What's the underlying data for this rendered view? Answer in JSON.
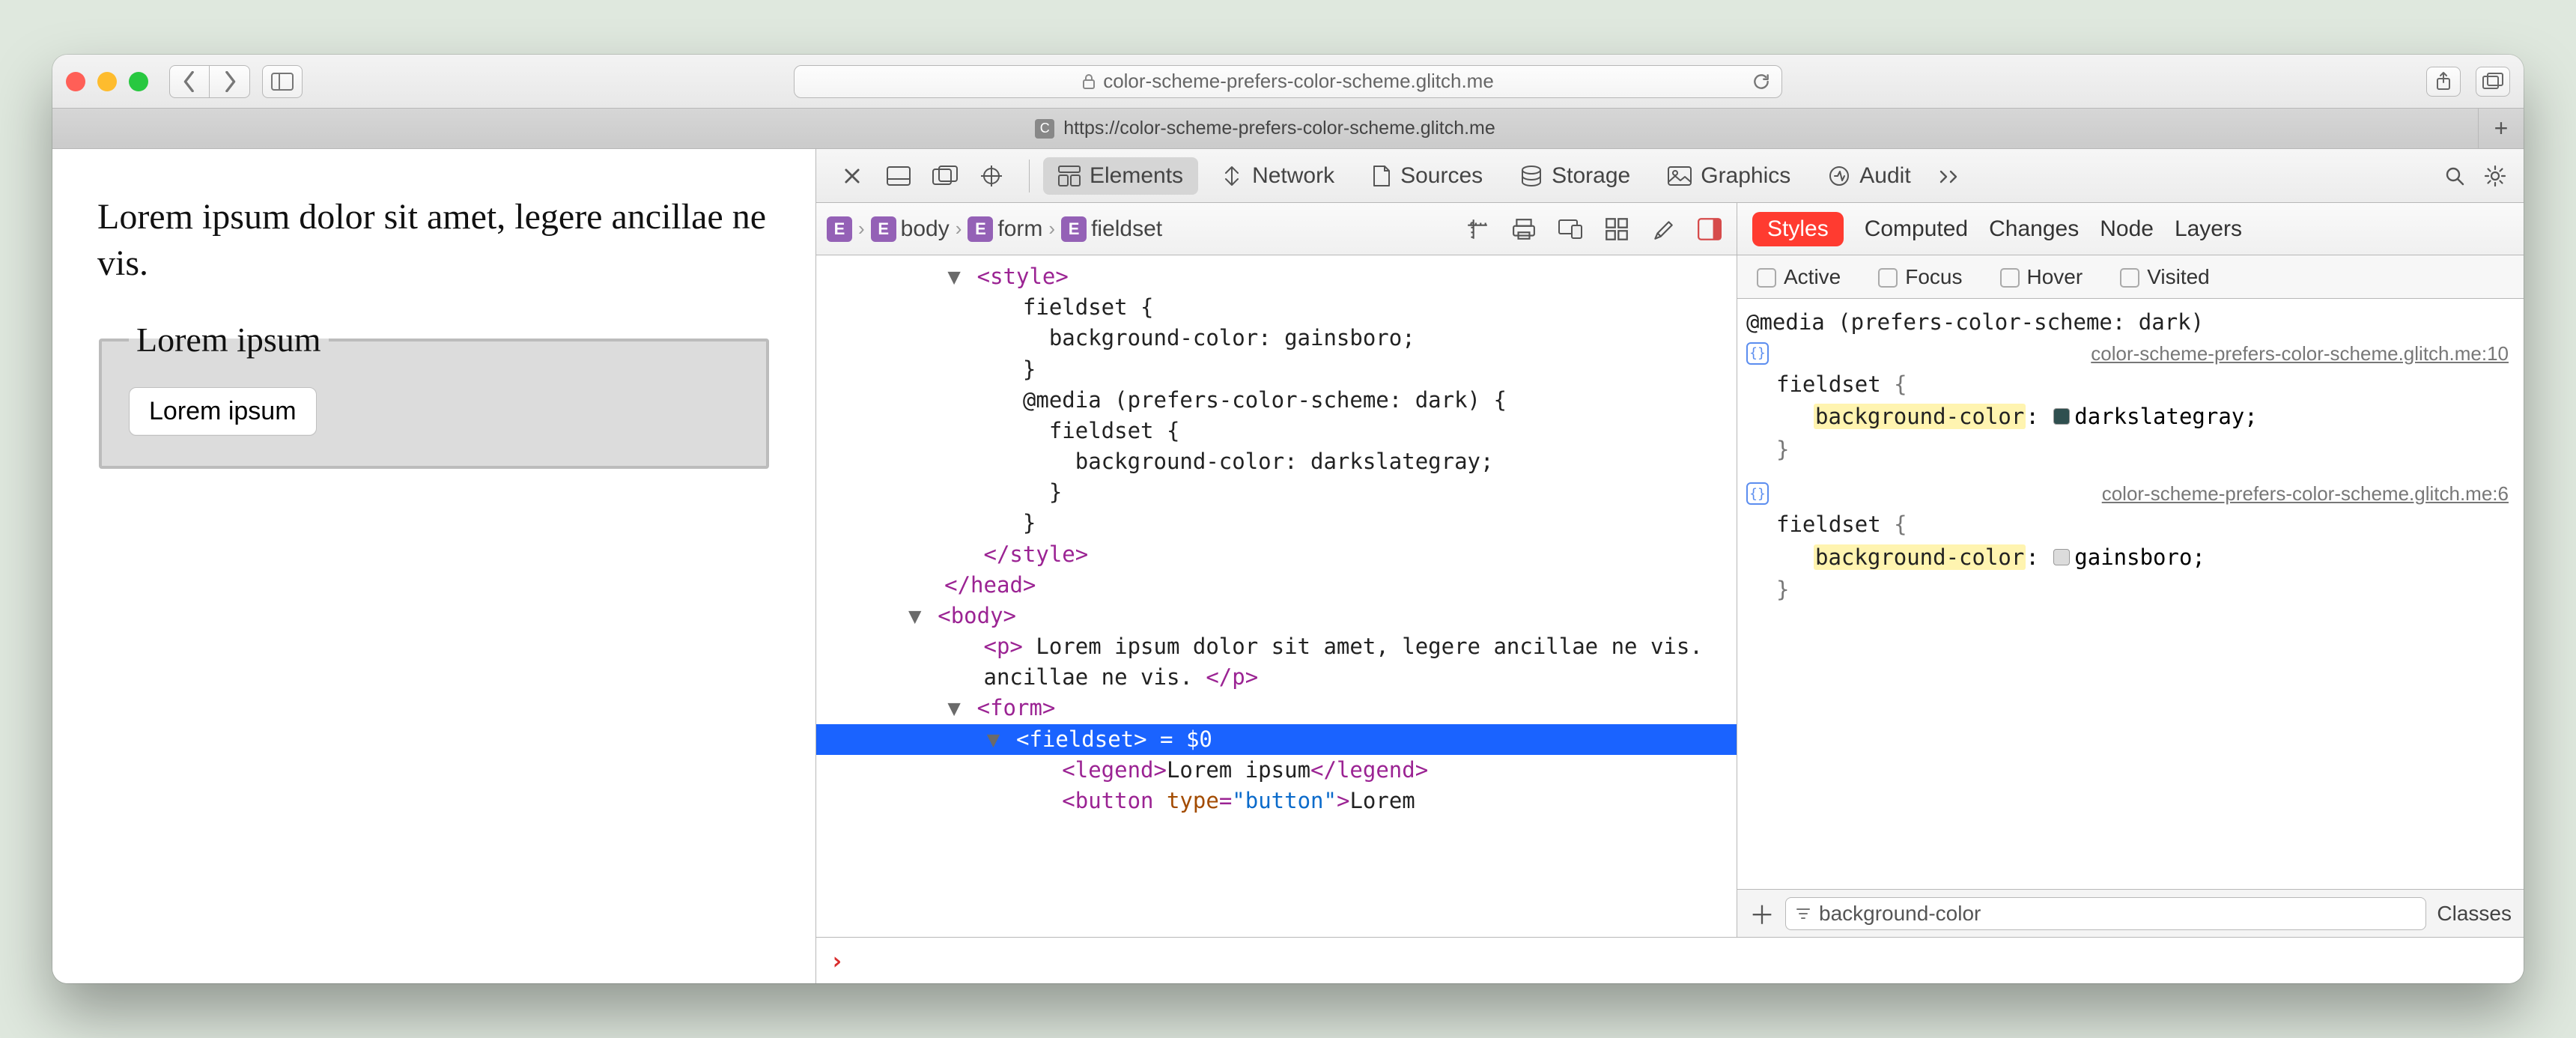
{
  "window": {
    "url_display": "color-scheme-prefers-color-scheme.glitch.me",
    "tab_title": "https://color-scheme-prefers-color-scheme.glitch.me",
    "favicon_letter": "C"
  },
  "page": {
    "paragraph": "Lorem ipsum dolor sit amet, legere ancillae ne vis.",
    "legend": "Lorem ipsum",
    "button": "Lorem ipsum"
  },
  "devtools": {
    "tabs": {
      "elements": "Elements",
      "network": "Network",
      "sources": "Sources",
      "storage": "Storage",
      "graphics": "Graphics",
      "audit": "Audit"
    },
    "breadcrumbs": [
      "body",
      "form",
      "fieldset"
    ],
    "dom": {
      "l1": "<style>",
      "l2": "fieldset {",
      "l3": "  background-color: gainsboro;",
      "l4": "}",
      "l5": "@media (prefers-color-scheme: dark) {",
      "l6": "  fieldset {",
      "l7": "    background-color: darkslategray;",
      "l8": "  }",
      "l9": "}",
      "l10": "</style>",
      "l11": "</head>",
      "l12": "<body>",
      "p_open": "<p>",
      "p_text": " Lorem ipsum dolor sit amet, legere ancillae ne vis. ",
      "p_close": "</p>",
      "form_open": "<form>",
      "fieldset_open": "<fieldset>",
      "eq0": " = $0",
      "legend_open": "<legend>",
      "legend_text": "Lorem ipsum",
      "legend_close": "</legend>",
      "button_open": "<button ",
      "button_attr_n": "type",
      "button_attr_v": "\"button\"",
      "button_gt": ">",
      "button_text": "Lorem"
    },
    "styles_tabs": {
      "styles": "Styles",
      "computed": "Computed",
      "changes": "Changes",
      "node": "Node",
      "layers": "Layers"
    },
    "force_states": {
      "active": "Active",
      "focus": "Focus",
      "hover": "Hover",
      "visited": "Visited"
    },
    "rules": {
      "mq": "@media (prefers-color-scheme: dark)",
      "src1": "color-scheme-prefers-color-scheme.glitch.me:10",
      "sel1": "fieldset",
      "prop1": "background-color",
      "val1": "darkslategray",
      "swatch1": "#2f4f4f",
      "src2": "color-scheme-prefers-color-scheme.glitch.me:6",
      "sel2": "fieldset",
      "prop2": "background-color",
      "val2": "gainsboro",
      "swatch2": "#dcdcdc"
    },
    "filter": {
      "value": "background-color",
      "classes_btn": "Classes"
    }
  }
}
